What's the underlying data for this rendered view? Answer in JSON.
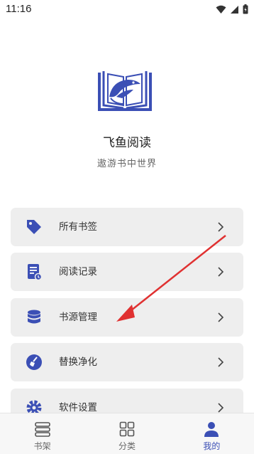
{
  "status_bar": {
    "time": "11:16",
    "icons": [
      "wifi-icon",
      "cellular-signal-icon",
      "battery-icon"
    ]
  },
  "app": {
    "name": "飞鱼阅读",
    "slogan": "遨游书中世界",
    "logo": "fish-book-logo"
  },
  "menu": {
    "items": [
      {
        "label": "所有书签",
        "icon": "bookmark-tag-icon"
      },
      {
        "label": "阅读记录",
        "icon": "reading-history-icon"
      },
      {
        "label": "书源管理",
        "icon": "database-icon"
      },
      {
        "label": "替换净化",
        "icon": "brush-clean-icon"
      },
      {
        "label": "软件设置",
        "icon": "settings-gear-icon"
      }
    ]
  },
  "annotation": {
    "type": "red-arrow",
    "points_to": "书源管理",
    "color": "#e03131"
  },
  "bottom_nav": {
    "items": [
      {
        "label": "书架",
        "icon": "bookshelf-icon",
        "active": false
      },
      {
        "label": "分类",
        "icon": "grid-category-icon",
        "active": false
      },
      {
        "label": "我的",
        "icon": "person-icon",
        "active": true
      }
    ]
  },
  "colors": {
    "accent": "#3b4fb5",
    "menu_bg": "#eeeeee",
    "inactive": "#666666",
    "arrow": "#e03131"
  }
}
